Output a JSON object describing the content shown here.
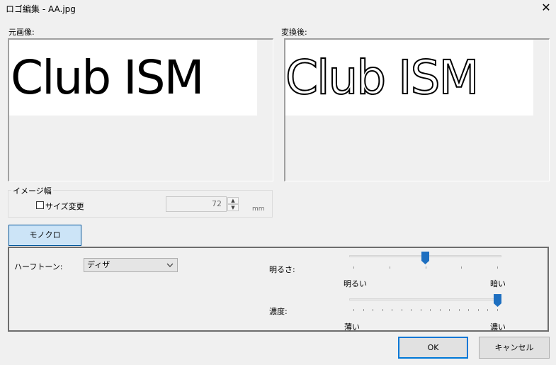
{
  "window": {
    "title": "ロゴ編集 - AA.jpg",
    "close_glyph": "✕"
  },
  "original": {
    "label": "元画像:",
    "logo_text": "Club ISM"
  },
  "converted": {
    "label": "変換後:",
    "logo_text": "Club ISM"
  },
  "image_width": {
    "group_label": "イメージ幅",
    "resize_label": "サイズ変更",
    "resize_checked": false,
    "value": "72",
    "unit": "mm"
  },
  "mono_button": "モノクロ",
  "halftone": {
    "label": "ハーフトーン:",
    "value": "ディザ"
  },
  "brightness": {
    "label": "明るさ:",
    "min_label": "明るい",
    "max_label": "暗い",
    "level": 0.5,
    "ticks": 5
  },
  "density": {
    "label": "濃度:",
    "min_label": "薄い",
    "max_label": "濃い",
    "level": 1.0,
    "ticks": 16
  },
  "buttons": {
    "ok": "OK",
    "cancel": "キャンセル"
  },
  "icons": {
    "close": "close-icon",
    "dropdown": "chevron-down-icon",
    "slider_thumb": "slider-thumb-icon"
  },
  "colors": {
    "accent": "#0078d7",
    "thumb": "#1e6fc0",
    "mono_bg": "#cce4f7"
  }
}
